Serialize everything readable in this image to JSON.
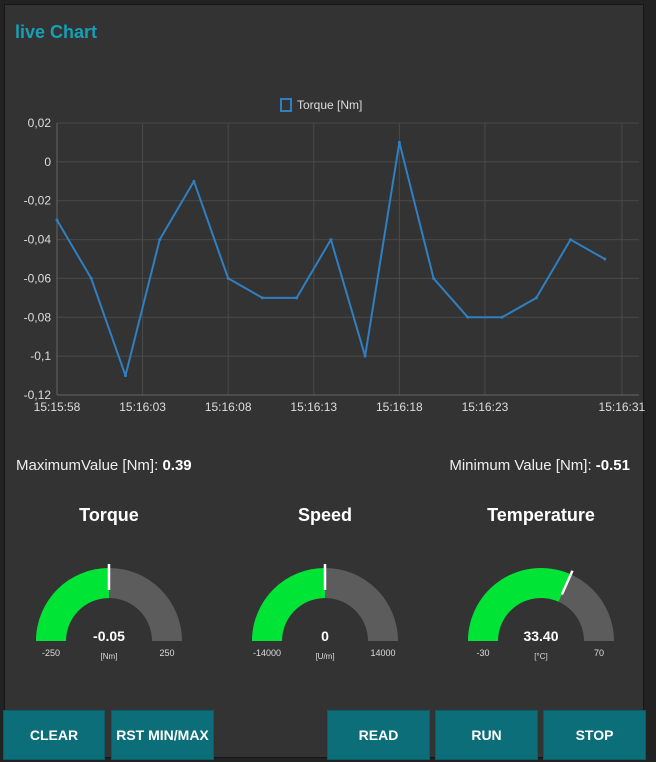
{
  "title": "live Chart",
  "chart_data": {
    "type": "line",
    "legend": "Torque [Nm]",
    "legend_position": "top-center",
    "series": [
      {
        "name": "Torque [Nm]",
        "color": "#2f7fc1",
        "x": [
          "15:15:58",
          "15:15:60",
          "15:16:02",
          "15:16:04",
          "15:16:06",
          "15:16:08",
          "15:16:10",
          "15:16:12",
          "15:16:14",
          "15:16:16",
          "15:16:18",
          "15:16:20",
          "15:16:22",
          "15:16:24",
          "15:16:26",
          "15:16:28",
          "15:16:30"
        ],
        "values": [
          -0.03,
          -0.06,
          -0.11,
          -0.04,
          -0.01,
          -0.06,
          -0.07,
          -0.07,
          -0.04,
          -0.1,
          0.01,
          -0.06,
          -0.08,
          -0.08,
          -0.07,
          -0.04,
          -0.05
        ]
      }
    ],
    "x_seconds": [
      0,
      2,
      4,
      6,
      8,
      10,
      12,
      14,
      16,
      18,
      20,
      22,
      24,
      26,
      28,
      30,
      32
    ],
    "x_ticks": [
      "15:15:58",
      "15:16:03",
      "15:16:08",
      "15:16:13",
      "15:16:18",
      "15:16:23",
      "15:16:31"
    ],
    "x_tick_seconds": [
      0,
      5,
      10,
      15,
      20,
      25,
      33
    ],
    "y_ticks": [
      "0,02",
      "0",
      "-0,02",
      "-0,04",
      "-0,06",
      "-0,08",
      "-0,1",
      "-0,12"
    ],
    "ylim": [
      -0.12,
      0.02
    ],
    "xlim_seconds": [
      0,
      34
    ],
    "grid": true
  },
  "stats": {
    "max_label": "MaximumValue [Nm]:",
    "max_value": "0.39",
    "min_label": "Minimum Value [Nm]:",
    "min_value": "-0.51"
  },
  "gauges": [
    {
      "title": "Torque",
      "value": -0.05,
      "value_text": "-0.05",
      "min": -250,
      "max": 250,
      "min_text": "-250",
      "max_text": "250",
      "unit": "[Nm]",
      "color": "#00e436"
    },
    {
      "title": "Speed",
      "value": 0,
      "value_text": "0",
      "min": -14000,
      "max": 14000,
      "min_text": "-14000",
      "max_text": "14000",
      "unit": "[U/m]",
      "color": "#00e436"
    },
    {
      "title": "Temperature",
      "value": 33.4,
      "value_text": "33.40",
      "min": -30,
      "max": 70,
      "min_text": "-30",
      "max_text": "70",
      "unit": "[°C]",
      "color": "#00e436"
    }
  ],
  "buttons": {
    "clear": "CLEAR",
    "rst": "RST MIN/MAX",
    "read": "READ",
    "run": "RUN",
    "stop": "STOP"
  }
}
